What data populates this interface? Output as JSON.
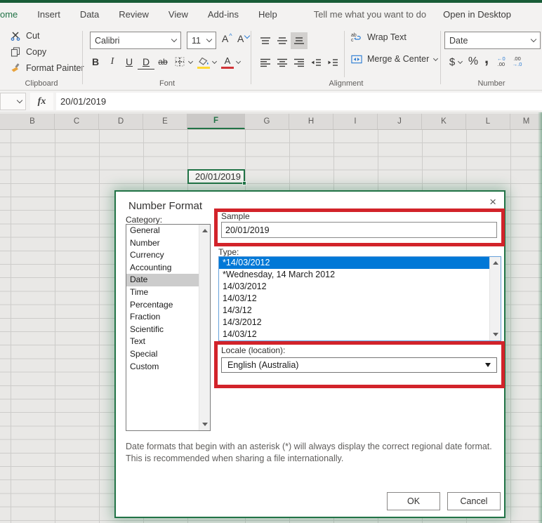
{
  "titlebar": {
    "tell_me": "Tell me what you want to do",
    "open_desktop": "Open in Desktop"
  },
  "tabs": [
    "ome",
    "Insert",
    "Data",
    "Review",
    "View",
    "Add-ins",
    "Help"
  ],
  "ribbon": {
    "clipboard": {
      "label": "Clipboard",
      "cut": "Cut",
      "copy": "Copy",
      "format_painter": "Format Painter"
    },
    "font": {
      "label": "Font",
      "font_name": "Calibri",
      "font_size": "11",
      "grow": "A",
      "shrink": "A",
      "bold": "B",
      "italic": "I",
      "underline": "U",
      "double_underline": "D",
      "strikethrough": "ab",
      "font_color_letter": "A"
    },
    "alignment": {
      "label": "Alignment",
      "wrap_text": "Wrap Text",
      "merge_center": "Merge & Center"
    },
    "number": {
      "label": "Number",
      "format": "Date",
      "currency": "$",
      "percent": "%",
      "comma": ",",
      "inc_top": "←0",
      "inc_bottom": ".00",
      "dec_top": ".00",
      "dec_bottom": "→.0"
    }
  },
  "formula_bar": {
    "fx": "fx",
    "value": "20/01/2019"
  },
  "sheet": {
    "columns": [
      "B",
      "C",
      "D",
      "E",
      "F",
      "G",
      "H",
      "I",
      "J",
      "K",
      "L",
      "M"
    ],
    "selected_column": "F",
    "selected_cell_value": "20/01/2019"
  },
  "dialog": {
    "title": "Number Format",
    "close": "×",
    "category_label": "Category:",
    "categories": [
      "General",
      "Number",
      "Currency",
      "Accounting",
      "Date",
      "Time",
      "Percentage",
      "Fraction",
      "Scientific",
      "Text",
      "Special",
      "Custom"
    ],
    "selected_category": "Date",
    "sample_label": "Sample",
    "sample_value": "20/01/2019",
    "type_label": "Type:",
    "types": [
      "*14/03/2012",
      "*Wednesday, 14 March 2012",
      "14/03/2012",
      "14/03/12",
      "14/3/12",
      "14/3/2012",
      "14/03/12"
    ],
    "selected_type": "*14/03/2012",
    "locale_label": "Locale (location):",
    "locale_value": "English (Australia)",
    "description_line1": "Date formats that begin with an asterisk (*) will always display the correct regional date format.",
    "description_line2": "This is recommended when sharing a file internationally.",
    "ok": "OK",
    "cancel": "Cancel"
  },
  "colors": {
    "accent_green": "#217346",
    "selection_blue": "#0078d7",
    "annotation_red": "#d2232a",
    "highlight_yellow": "#ffd932",
    "font_red": "#d13438"
  }
}
